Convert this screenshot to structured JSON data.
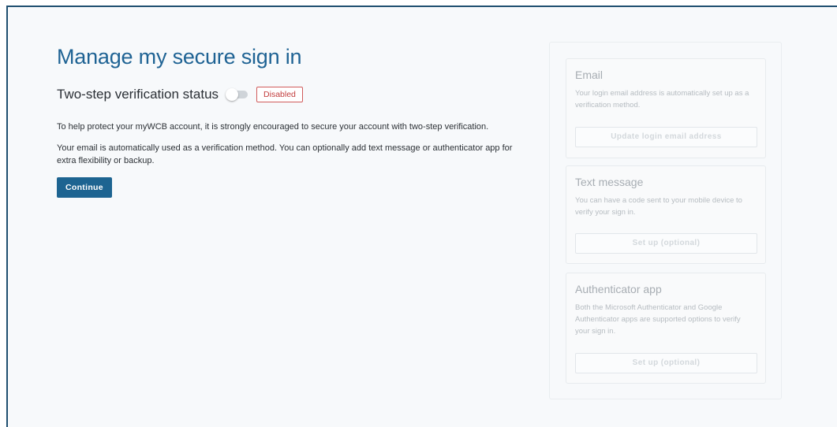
{
  "page": {
    "title": "Manage my secure sign in",
    "status_label": "Two-step verification status",
    "status_badge": "Disabled",
    "toggle_on": false,
    "paragraph_1": "To help protect your myWCB account, it is strongly encouraged to secure your account with two-step verification.",
    "paragraph_2": "Your email is automatically used as a verification method. You can optionally add text message or authenticator app for extra flexibility or backup.",
    "continue_label": "Continue"
  },
  "methods": {
    "email": {
      "title": "Email",
      "description": "Your login email address is automatically set up as a verification method.",
      "button": "Update login email address"
    },
    "text_message": {
      "title": "Text message",
      "description": "You can have a code sent to your mobile device to verify your sign in.",
      "button": "Set up (optional)"
    },
    "authenticator": {
      "title": "Authenticator app",
      "description": "Both the Microsoft Authenticator and Google Authenticator apps are supported options to verify your sign in.",
      "button": "Set up (optional)"
    }
  },
  "colors": {
    "title": "#1f6394",
    "primary_button": "#1d6491",
    "badge_disabled": "#c23c3c",
    "frame_border": "#1f4f70"
  }
}
